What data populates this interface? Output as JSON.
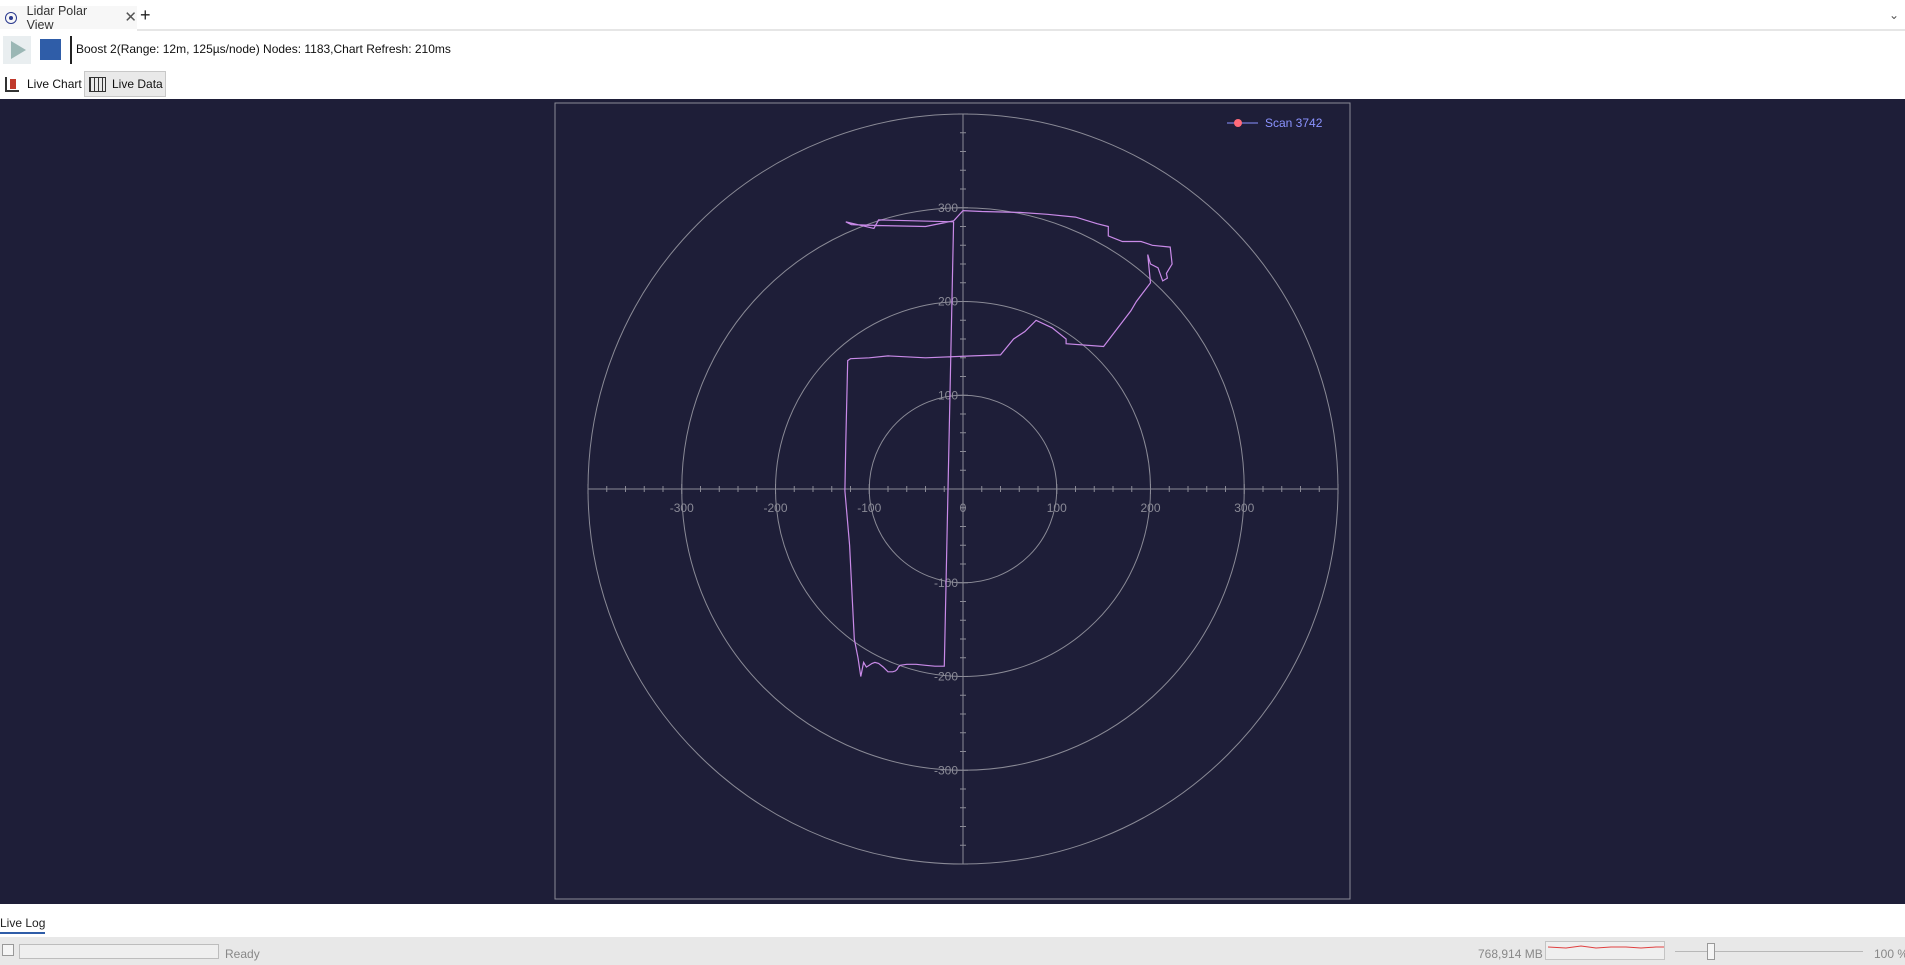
{
  "tabbar": {
    "tab_label": "Lidar Polar View",
    "close_symbol": "✕",
    "new_tab_symbol": "+",
    "overflow_symbol": "⌄"
  },
  "toolbar": {
    "play_icon": "play-icon",
    "stop_icon": "stop-icon",
    "status": "Boost 2(Range: 12m, 125µs/node) Nodes: 1183,Chart Refresh: 210ms"
  },
  "view_tabs": [
    {
      "label": "Live Chart",
      "icon": "chart-icon",
      "selected": true
    },
    {
      "label": "Live Data",
      "icon": "data-grid-icon",
      "selected": false
    }
  ],
  "chart_data": {
    "type": "polar-scatter",
    "legend": {
      "placement": "top-right",
      "entries": [
        "Scan 3742"
      ]
    },
    "colors": {
      "background": "#1e1e38",
      "series_line": "#c98ae8",
      "legend_marker": "#ff6b7a",
      "legend_text": "#8b93ff",
      "grid": "#8a8a96"
    },
    "axis_range": [
      -400,
      400
    ],
    "rings": [
      100,
      200,
      300,
      400
    ],
    "x_tick_labels": [
      "-300",
      "-200",
      "-100",
      "0",
      "100",
      "200",
      "300"
    ],
    "y_tick_labels": [
      "300",
      "200",
      "100",
      "-100",
      "-200",
      "-300"
    ],
    "series": [
      {
        "name": "Scan 3742",
        "x": [
          -10,
          -90,
          -95,
          -125,
          -119,
          -86,
          -40,
          -10,
          0,
          20,
          60,
          90,
          120,
          143,
          155,
          155,
          160,
          170,
          190,
          202,
          221,
          223,
          217,
          218,
          213,
          208,
          200,
          197,
          200,
          185,
          179,
          150,
          110,
          110,
          95,
          78,
          66,
          54,
          40,
          10,
          -40,
          -80,
          -100,
          -120,
          -123,
          -125,
          -126,
          -121,
          -118,
          -116,
          -112,
          -109,
          -106,
          -103,
          -100,
          -97,
          -94,
          -90,
          -85,
          -80,
          -75,
          -72,
          -70,
          -69,
          -68,
          -67,
          -60,
          -50,
          -40,
          -30,
          -20
        ],
        "y": [
          285,
          287,
          278,
          285,
          282,
          281,
          280,
          286,
          297,
          296,
          295,
          293,
          290,
          283,
          280,
          270,
          268,
          264,
          264,
          260,
          258,
          240,
          230,
          225,
          222,
          236,
          240,
          250,
          220,
          200,
          190,
          152,
          155,
          160,
          172,
          180,
          168,
          160,
          143,
          142,
          140,
          142,
          140,
          139,
          137,
          50,
          -2,
          -60,
          -120,
          -160,
          -180,
          -200,
          -185,
          -190,
          -188,
          -186,
          -185,
          -186,
          -190,
          -195,
          -195,
          -194,
          -192,
          -190,
          -189,
          -188,
          -187,
          -187,
          -188,
          -189,
          -189
        ]
      }
    ]
  },
  "livelog": {
    "label": "Live Log"
  },
  "statusbar": {
    "ready": "Ready",
    "memory": "768,914 MB",
    "zoom_value": 0.2,
    "zoom_pct": "100 %"
  }
}
